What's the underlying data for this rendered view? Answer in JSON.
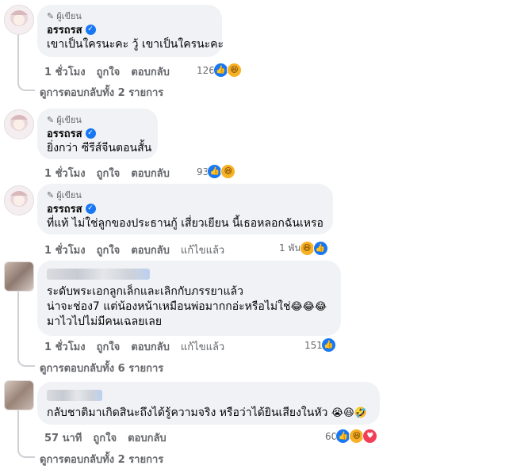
{
  "comments": [
    {
      "author_badge": "ผู้เขียน",
      "author": "อรรถรส",
      "text": [
        "เขาเป็นใครนะคะ วู้ เขาเป็นใครนะคะ"
      ],
      "time": "1 ชั่วโมง",
      "like": "ถูกใจ",
      "reply": "ตอบกลับ",
      "edited": "",
      "reaction_count": "126",
      "reactions": [
        "like-icon",
        "haha-icon"
      ],
      "view_replies": "ดูการตอบกลับทั้ง 2 รายการ"
    },
    {
      "author_badge": "ผู้เขียน",
      "author": "อรรถรส",
      "text": [
        "ยิ่งกว่า ซีรีส์จีนตอนสั้น"
      ],
      "time": "1 ชั่วโมง",
      "like": "ถูกใจ",
      "reply": "ตอบกลับ",
      "edited": "",
      "reaction_count": "93",
      "reactions": [
        "like-icon",
        "haha-icon"
      ],
      "view_replies": ""
    },
    {
      "author_badge": "ผู้เขียน",
      "author": "อรรถรส",
      "text": [
        "ที่แท้ ไม่ใช่ลูกของประธานกู้ เสี่ยวเยียน นี้เธอหลอกฉันเหรอ"
      ],
      "time": "1 ชั่วโมง",
      "like": "ถูกใจ",
      "reply": "ตอบกลับ",
      "edited": "แก้ไขแล้ว",
      "reaction_count": "1 พัน",
      "reactions": [
        "haha-icon",
        "like-icon"
      ],
      "view_replies": ""
    },
    {
      "author_badge": "",
      "author": "",
      "text": [
        "ระดับพระเอกลูกเล็กและเลิกกับภรรยาแล้ว",
        "น่าจะช่อง7 แต่น้องหน้าเหมือนพ่อมากกอ่ะหรือไม่ใช่",
        "มาไวไปไม่มีคนเฉลยเลย"
      ],
      "text_emoji": "😂😂😂",
      "time": "1 ชั่วโมง",
      "like": "ถูกใจ",
      "reply": "ตอบกลับ",
      "edited": "แก้ไขแล้ว",
      "reaction_count": "151",
      "reactions": [
        "like-icon"
      ],
      "view_replies": "ดูการตอบกลับทั้ง 6 รายการ"
    },
    {
      "author_badge": "",
      "author": "",
      "text": [
        "กลับชาติมาเกิดสินะถึงได้รู้ความจริง หรือว่าได้ยินเสียงในหัว"
      ],
      "text_emoji": "😭😆🤣",
      "time": "57 นาที",
      "like": "ถูกใจ",
      "reply": "ตอบกลับ",
      "edited": "",
      "reaction_count": "60",
      "reactions": [
        "like-icon",
        "haha-icon",
        "love-icon"
      ],
      "view_replies": "ดูการตอบกลับทั้ง 2 รายการ"
    }
  ],
  "colors": {
    "bubble": "#f0f2f5",
    "meta": "#65676b",
    "like": "#1877f2",
    "haha": "#f7b125",
    "love": "#f33e58"
  }
}
